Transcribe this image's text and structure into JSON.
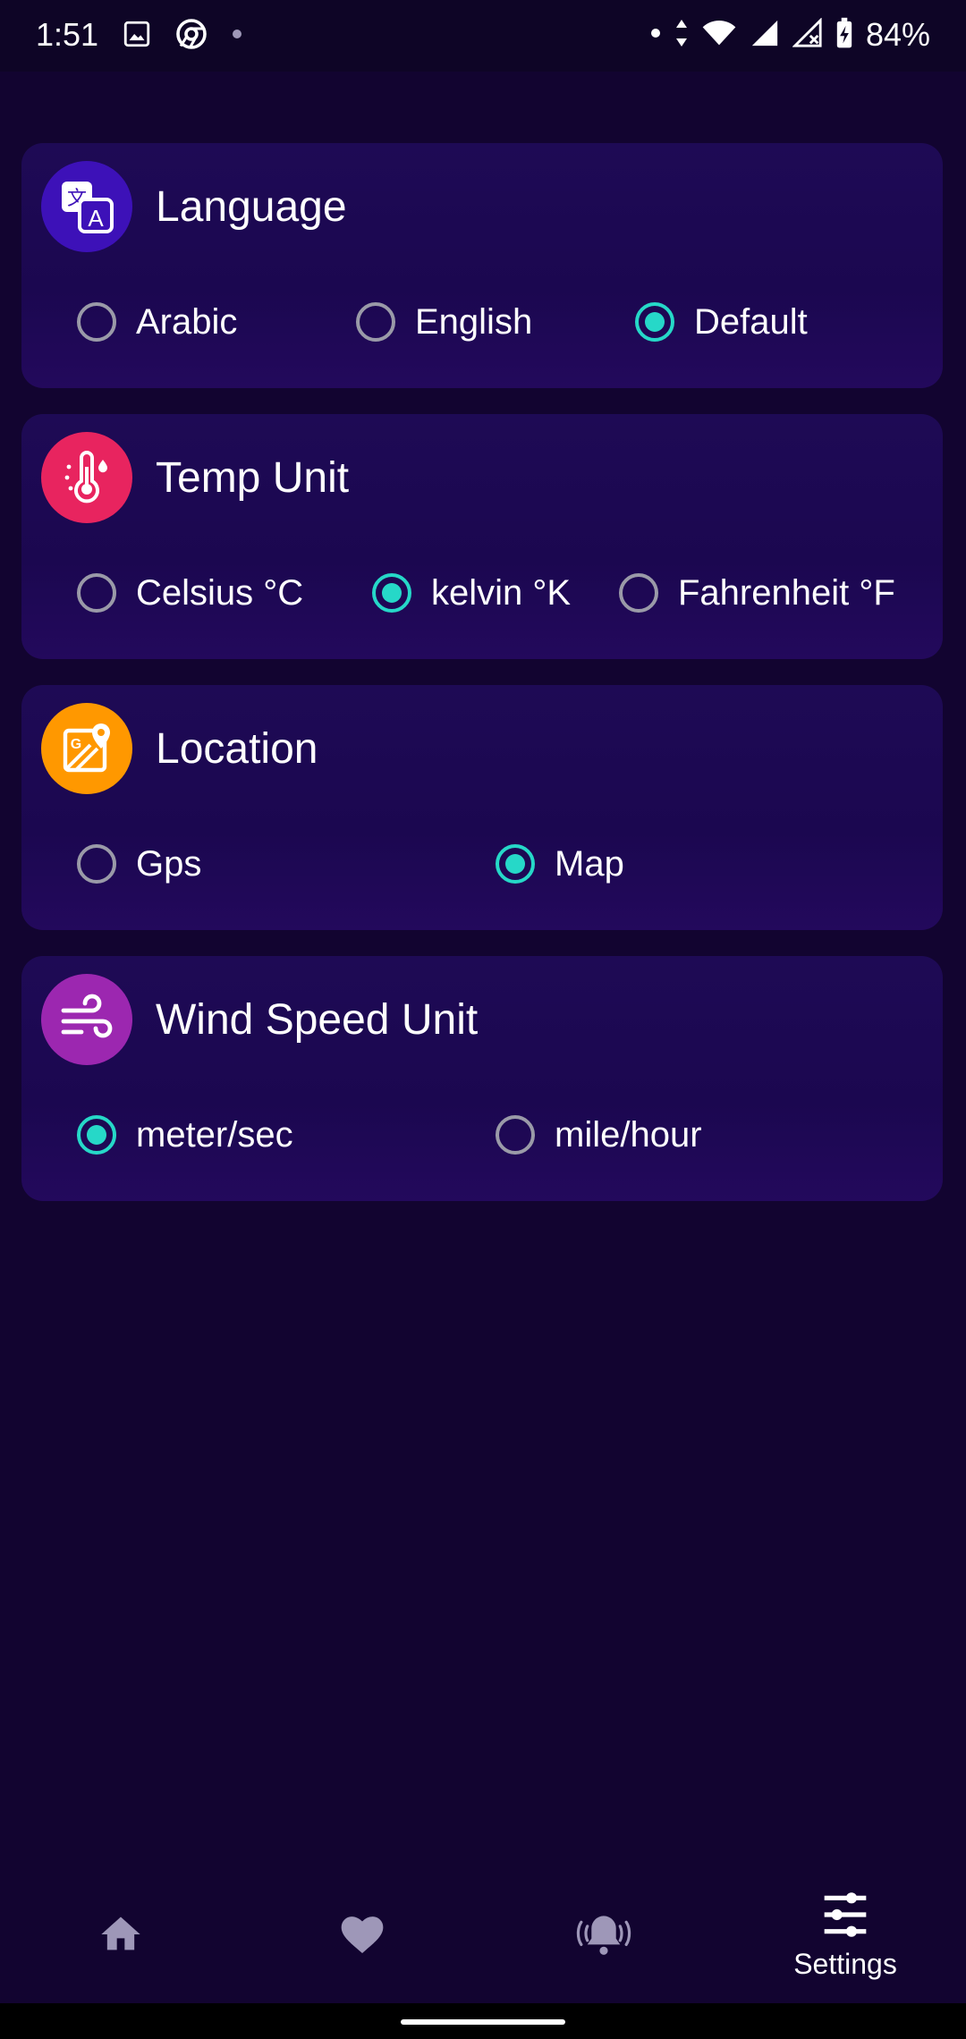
{
  "status_bar": {
    "time": "1:51",
    "battery": "84%",
    "icons": [
      "gallery-icon",
      "chrome-icon",
      "dot-icon",
      "data-arrows-icon",
      "wifi-icon",
      "signal-icon",
      "signal-no-service-icon",
      "battery-charging-icon"
    ]
  },
  "settings": {
    "language": {
      "title": "Language",
      "icon": "translate-icon",
      "icon_color": "#3d11b8",
      "options": [
        "Arabic",
        "English",
        "Default"
      ],
      "selected": "Default"
    },
    "temp_unit": {
      "title": "Temp Unit",
      "icon": "thermometer-icon",
      "icon_color": "#e8245f",
      "options": [
        "Celsius °C",
        "kelvin °K",
        "Fahrenheit °F"
      ],
      "selected": "kelvin °K"
    },
    "location": {
      "title": "Location",
      "icon": "map-icon",
      "icon_color": "#ff9800",
      "options": [
        "Gps",
        "Map"
      ],
      "selected": "Map"
    },
    "wind_speed_unit": {
      "title": "Wind Speed Unit",
      "icon": "wind-icon",
      "icon_color": "#9c27b0",
      "options": [
        "meter/sec",
        "mile/hour"
      ],
      "selected": "meter/sec"
    }
  },
  "bottom_nav": {
    "items": [
      {
        "icon": "home-icon"
      },
      {
        "icon": "heart-icon"
      },
      {
        "icon": "alarm-bell-icon"
      },
      {
        "icon": "settings-sliders-icon",
        "label": "Settings",
        "active": true
      }
    ]
  },
  "colors": {
    "background": "#120430",
    "card": "#1e0a55",
    "accent": "#26d8c8",
    "radio_unchecked": "#9a9aa8",
    "nav_inactive": "#9e97b8"
  }
}
